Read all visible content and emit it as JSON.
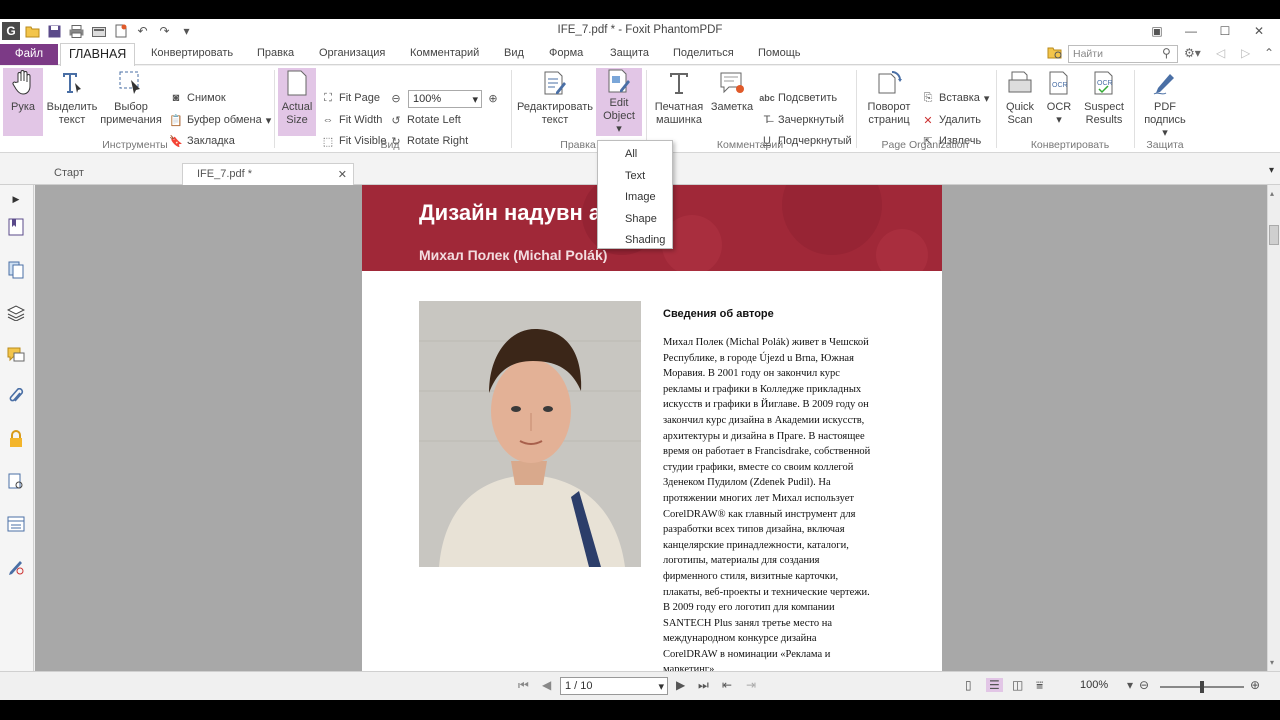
{
  "window": {
    "title": "IFE_7.pdf * - Foxit PhantomPDF",
    "controls": [
      "restore-icon",
      "minimize-icon",
      "maximize-icon",
      "close-icon"
    ]
  },
  "ribbon_tabs": {
    "file": "Файл",
    "items": [
      "ГЛАВНАЯ",
      "Конвертировать",
      "Правка",
      "Организация",
      "Комментарий",
      "Вид",
      "Форма",
      "Защита",
      "Поделиться",
      "Помощь"
    ],
    "active": "ГЛАВНАЯ"
  },
  "search": {
    "placeholder": "Найти"
  },
  "ribbon": {
    "tools": {
      "hand": "Рука",
      "select_text": "Выделить текст",
      "select_note": "Выбор примечания",
      "snapshot": "Снимок",
      "clipboard": "Буфер обмена",
      "bookmark": "Закладка",
      "group": "Инструменты"
    },
    "view": {
      "actual_size": "Actual Size",
      "fit_page": "Fit Page",
      "fit_width": "Fit Width",
      "fit_visible": "Fit Visible",
      "zoom_value": "100%",
      "rotate_left": "Rotate Left",
      "rotate_right": "Rotate Right",
      "group": "Вид"
    },
    "edit": {
      "edit_text": "Редактировать текст",
      "edit_object": "Edit Object",
      "group": "Правка"
    },
    "comment": {
      "typewriter": "Печатная машинка",
      "note": "Заметка",
      "highlight": "Подсветить",
      "strikeout": "Зачеркнутый",
      "underline": "Подчеркнутый",
      "group": "Комментарий"
    },
    "organize": {
      "rotate_pages": "Поворот страниц",
      "insert": "Вставка",
      "delete": "Удалить",
      "extract": "Извлечь",
      "group": "Page Organization"
    },
    "convert": {
      "quick_scan": "Quick Scan",
      "ocr": "OCR",
      "suspect": "Suspect Results",
      "group": "Конвертировать"
    },
    "protect": {
      "sign": "PDF подпись",
      "group": "Защита"
    }
  },
  "edit_object_menu": [
    "All",
    "Text",
    "Image",
    "Shape",
    "Shading"
  ],
  "doc_tabs": {
    "start": "Старт",
    "file": "IFE_7.pdf *"
  },
  "document": {
    "title": "Дизайн надувн атра",
    "author_line": "Михал Полек (Michal Polák)",
    "bio_heading": "Сведения об авторе",
    "bio_lines": [
      "Михал Полек (Michal Polák) живет в Чешской",
      "Республике, в городе Újezd u Brna, Южная",
      "Моравия. В 2001 году он закончил курс",
      "рекламы и графики в Колледже прикладных",
      "искусств и графики в Йиглаве. В 2009 году он",
      "закончил курс дизайна в Академии искусств,",
      "архитектуры и дизайна в Праге. В настоящее",
      "время он работает в Francisdrake, собственной",
      "студии графики, вместе со своим коллегой",
      "Зденеком Пудилом (Zdenek Pudil). На",
      "протяжении многих лет Михал использует",
      "CorelDRAW® как главный инструмент для",
      "разработки всех типов дизайна, включая",
      "канцелярские принадлежности, каталоги,",
      "логотипы, материалы для создания",
      "фирменного стиля, визитные карточки,",
      "плакаты, веб-проекты и технические чертежи.",
      "В 2009 году его логотип для компании",
      "SANTECH Plus занял третье место на",
      "международном конкурсе дизайна",
      "CorelDRAW в номинации «Реклама и",
      "маркетинг»"
    ]
  },
  "status": {
    "page": "1 / 10",
    "zoom": "100%",
    "zoom_level_fraction": 0.5
  },
  "colors": {
    "accent": "#7c3a86",
    "banner": "#a02838",
    "selected": "#e2c6e6"
  }
}
